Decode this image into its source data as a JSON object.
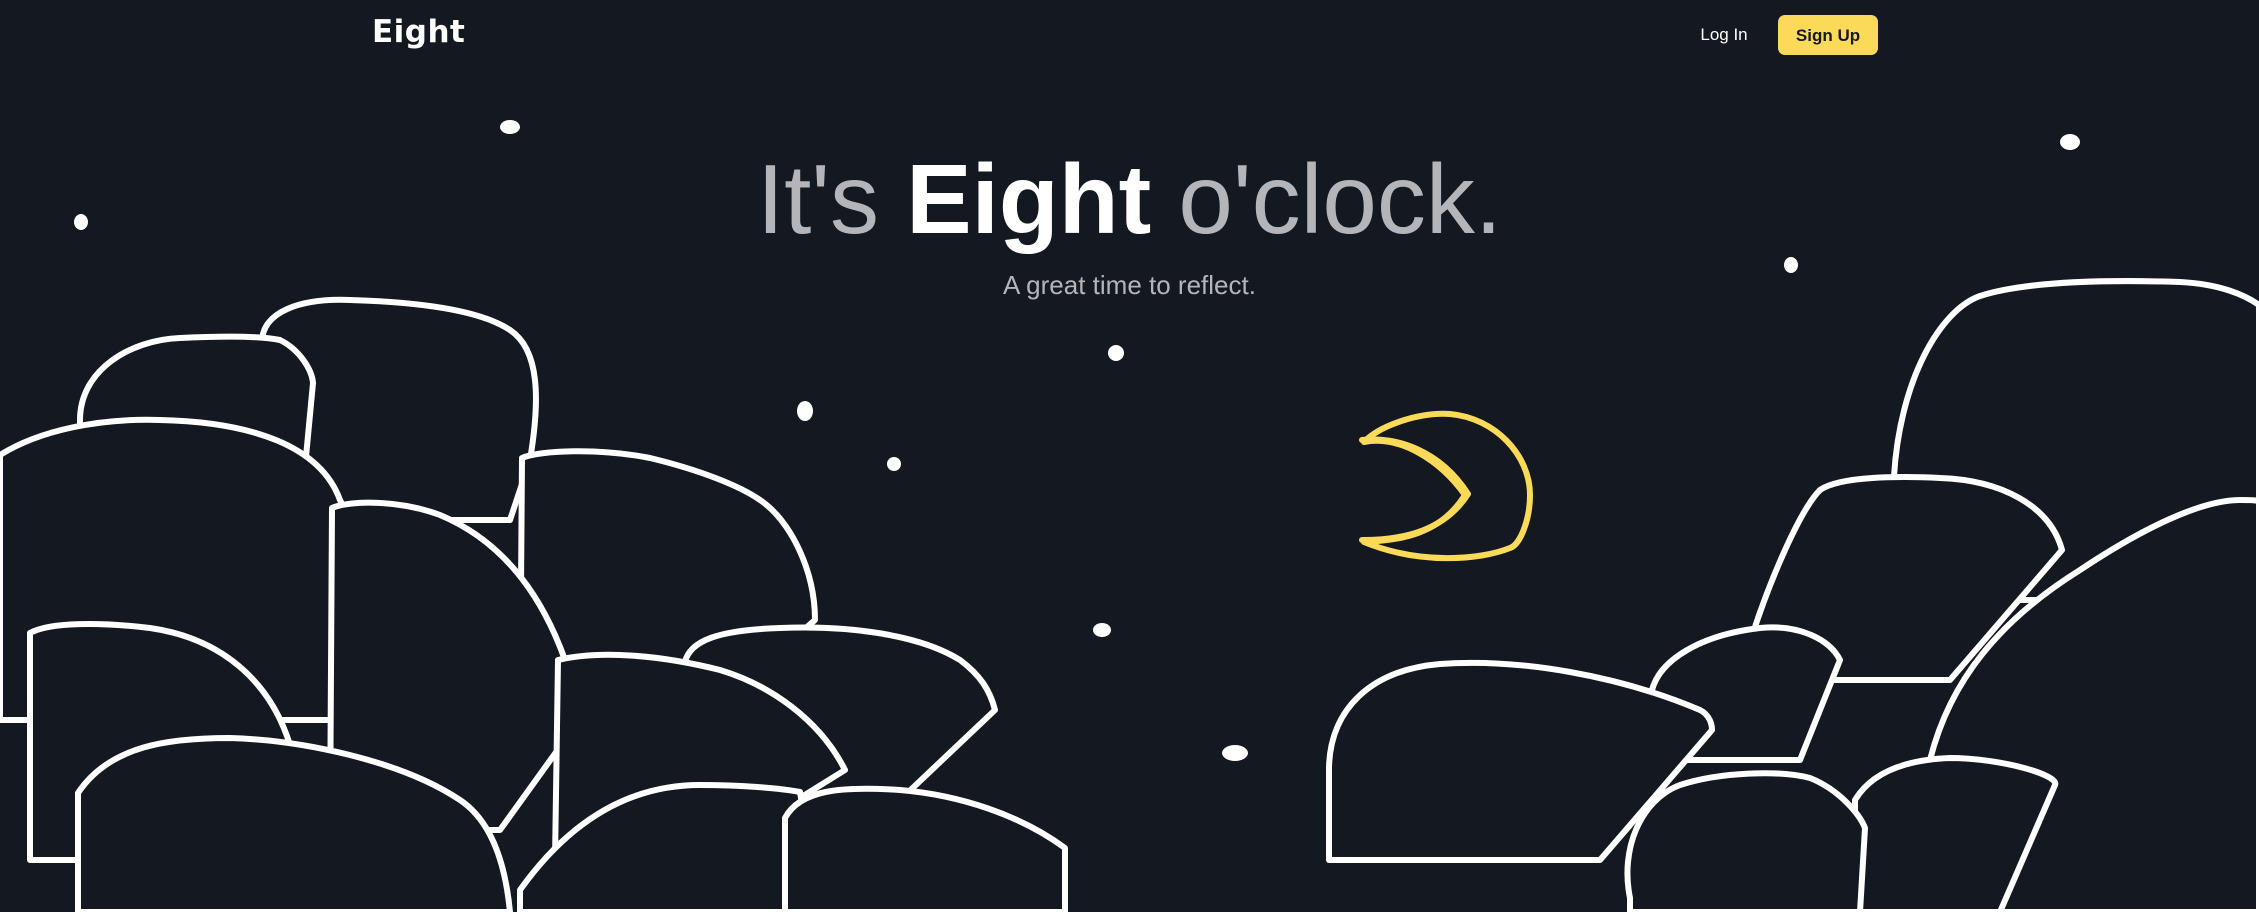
{
  "nav": {
    "logo": "Eight",
    "login_label": "Log In",
    "signup_label": "Sign Up"
  },
  "hero": {
    "headline_before": "It's ",
    "headline_brand": "Eight",
    "headline_after": " o'clock.",
    "subtitle": "A great time to reflect."
  },
  "colors": {
    "background": "#141821",
    "accent": "#fbd959",
    "muted_text": "#b3b5ba",
    "line": "#ffffff"
  },
  "icons": {
    "moon": "moon-icon",
    "stars": "star-icon"
  }
}
